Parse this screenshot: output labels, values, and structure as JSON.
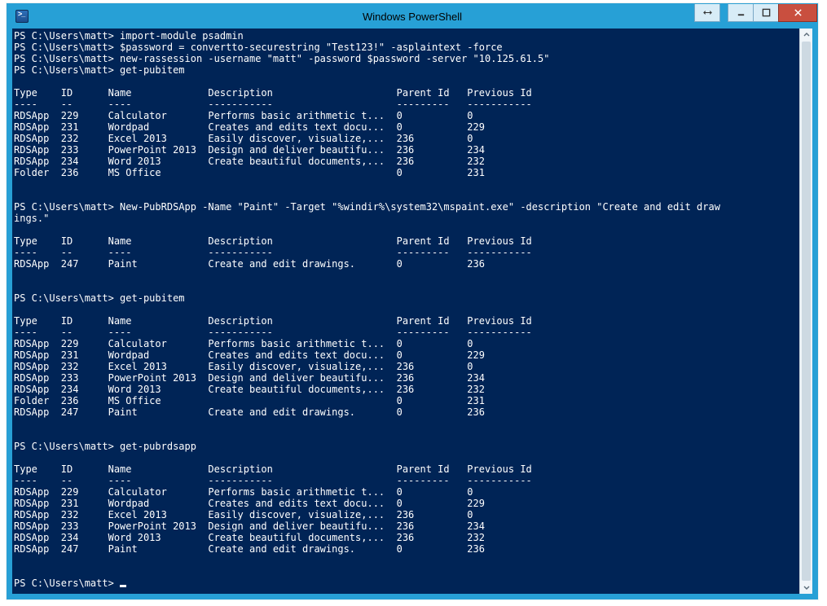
{
  "window": {
    "title": "Windows PowerShell"
  },
  "prompt": "PS C:\\Users\\matt>",
  "commands": {
    "c1": "import-module psadmin",
    "c2": "$password = convertto-securestring \"Test123!\" -asplaintext -force",
    "c3": "new-rassession -username \"matt\" -password $password -server \"10.125.61.5\"",
    "c4": "get-pubitem",
    "c5": "New-PubRDSApp -Name \"Paint\" -Target \"%windir%\\system32\\mspaint.exe\" -description \"Create and edit draw",
    "c5_wrap": "ings.\"",
    "c6": "get-pubitem",
    "c7": "get-pubrdsapp",
    "c8": ""
  },
  "columns": {
    "type": "Type",
    "id": "ID",
    "name": "Name",
    "description": "Description",
    "parentId": "Parent Id",
    "previousId": "Previous Id"
  },
  "underlines": {
    "type": "----",
    "id": "--",
    "name": "----",
    "description": "-----------",
    "parentId": "---------",
    "previousId": "-----------"
  },
  "table1": [
    {
      "type": "RDSApp",
      "id": "229",
      "name": "Calculator",
      "desc": "Performs basic arithmetic t...",
      "pid": "0",
      "prev": "0"
    },
    {
      "type": "RDSApp",
      "id": "231",
      "name": "Wordpad",
      "desc": "Creates and edits text docu...",
      "pid": "0",
      "prev": "229"
    },
    {
      "type": "RDSApp",
      "id": "232",
      "name": "Excel 2013",
      "desc": "Easily discover, visualize,...",
      "pid": "236",
      "prev": "0"
    },
    {
      "type": "RDSApp",
      "id": "233",
      "name": "PowerPoint 2013",
      "desc": "Design and deliver beautifu...",
      "pid": "236",
      "prev": "234"
    },
    {
      "type": "RDSApp",
      "id": "234",
      "name": "Word 2013",
      "desc": "Create beautiful documents,...",
      "pid": "236",
      "prev": "232"
    },
    {
      "type": "Folder",
      "id": "236",
      "name": "MS Office",
      "desc": "",
      "pid": "0",
      "prev": "231"
    }
  ],
  "table2": [
    {
      "type": "RDSApp",
      "id": "247",
      "name": "Paint",
      "desc": "Create and edit drawings.",
      "pid": "0",
      "prev": "236"
    }
  ],
  "table3": [
    {
      "type": "RDSApp",
      "id": "229",
      "name": "Calculator",
      "desc": "Performs basic arithmetic t...",
      "pid": "0",
      "prev": "0"
    },
    {
      "type": "RDSApp",
      "id": "231",
      "name": "Wordpad",
      "desc": "Creates and edits text docu...",
      "pid": "0",
      "prev": "229"
    },
    {
      "type": "RDSApp",
      "id": "232",
      "name": "Excel 2013",
      "desc": "Easily discover, visualize,...",
      "pid": "236",
      "prev": "0"
    },
    {
      "type": "RDSApp",
      "id": "233",
      "name": "PowerPoint 2013",
      "desc": "Design and deliver beautifu...",
      "pid": "236",
      "prev": "234"
    },
    {
      "type": "RDSApp",
      "id": "234",
      "name": "Word 2013",
      "desc": "Create beautiful documents,...",
      "pid": "236",
      "prev": "232"
    },
    {
      "type": "Folder",
      "id": "236",
      "name": "MS Office",
      "desc": "",
      "pid": "0",
      "prev": "231"
    },
    {
      "type": "RDSApp",
      "id": "247",
      "name": "Paint",
      "desc": "Create and edit drawings.",
      "pid": "0",
      "prev": "236"
    }
  ],
  "table4": [
    {
      "type": "RDSApp",
      "id": "229",
      "name": "Calculator",
      "desc": "Performs basic arithmetic t...",
      "pid": "0",
      "prev": "0"
    },
    {
      "type": "RDSApp",
      "id": "231",
      "name": "Wordpad",
      "desc": "Creates and edits text docu...",
      "pid": "0",
      "prev": "229"
    },
    {
      "type": "RDSApp",
      "id": "232",
      "name": "Excel 2013",
      "desc": "Easily discover, visualize,...",
      "pid": "236",
      "prev": "0"
    },
    {
      "type": "RDSApp",
      "id": "233",
      "name": "PowerPoint 2013",
      "desc": "Design and deliver beautifu...",
      "pid": "236",
      "prev": "234"
    },
    {
      "type": "RDSApp",
      "id": "234",
      "name": "Word 2013",
      "desc": "Create beautiful documents,...",
      "pid": "236",
      "prev": "232"
    },
    {
      "type": "RDSApp",
      "id": "247",
      "name": "Paint",
      "desc": "Create and edit drawings.",
      "pid": "0",
      "prev": "236"
    }
  ]
}
